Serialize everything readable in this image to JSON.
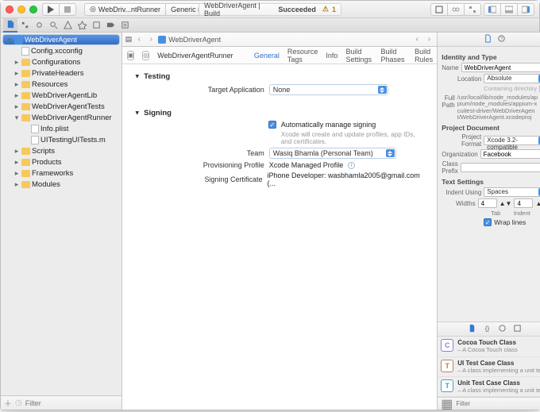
{
  "titlebar": {
    "scheme_left": "WebDriv...ntRunner",
    "scheme_right": "Generic iOS Device",
    "status_prefix": "WebDriverAgent | Build",
    "status_bold": "Succeeded",
    "warn_count": "1"
  },
  "jumpbar": {
    "back": "‹",
    "fwd": "›",
    "project": "WebDriverAgent",
    "list_icon": "≡"
  },
  "nav": {
    "items": [
      {
        "name": "WebDriverAgent",
        "type": "proj",
        "ind": 0,
        "sel": true,
        "tri": "open"
      },
      {
        "name": "Config.xcconfig",
        "type": "file",
        "ind": 1,
        "tri": "none"
      },
      {
        "name": "Configurations",
        "type": "folder",
        "ind": 1,
        "tri": "closed"
      },
      {
        "name": "PrivateHeaders",
        "type": "folder",
        "ind": 1,
        "tri": "closed"
      },
      {
        "name": "Resources",
        "type": "folder",
        "ind": 1,
        "tri": "closed"
      },
      {
        "name": "WebDriverAgentLib",
        "type": "folder",
        "ind": 1,
        "tri": "closed"
      },
      {
        "name": "WebDriverAgentTests",
        "type": "folder",
        "ind": 1,
        "tri": "closed"
      },
      {
        "name": "WebDriverAgentRunner",
        "type": "folder",
        "ind": 1,
        "tri": "open"
      },
      {
        "name": "Info.plist",
        "type": "file",
        "ind": 2,
        "tri": "none"
      },
      {
        "name": "UITestingUITests.m",
        "type": "file",
        "ind": 2,
        "tri": "none"
      },
      {
        "name": "Scripts",
        "type": "folder",
        "ind": 1,
        "tri": "closed"
      },
      {
        "name": "Products",
        "type": "folder",
        "ind": 1,
        "tri": "closed"
      },
      {
        "name": "Frameworks",
        "type": "folder",
        "ind": 1,
        "tri": "closed"
      },
      {
        "name": "Modules",
        "type": "folder",
        "ind": 1,
        "tri": "closed"
      }
    ],
    "filter_placeholder": "Filter"
  },
  "mid": {
    "target": "WebDriverAgentRunner",
    "tabs": [
      "General",
      "Resource Tags",
      "Info",
      "Build Settings",
      "Build Phases",
      "Build Rules"
    ],
    "active_tab": 0,
    "testing_hdr": "Testing",
    "target_app_label": "Target Application",
    "target_app_value": "None",
    "signing_hdr": "Signing",
    "auto_label": "Automatically manage signing",
    "auto_note": "Xcode will create and update profiles, app IDs, and certificates.",
    "team_label": "Team",
    "team_value": "Wasiq Bhamla (Personal Team)",
    "prov_label": "Provisioning Profile",
    "prov_value": "Xcode Managed Profile",
    "cert_label": "Signing Certificate",
    "cert_value": "iPhone Developer: wasbhamla2005@gmail.com (..."
  },
  "ins": {
    "identity_hdr": "Identity and Type",
    "name_k": "Name",
    "name_v": "WebDriverAgent",
    "loc_k": "Location",
    "loc_v": "Absolute",
    "contdir": "Containing directory",
    "fullpath_k": "Full Path",
    "fullpath_v": "/usr/local/lib/node_modules/appium/node_modules/appium-xcuitest-driver/WebDriverAgent/WebDriverAgent.xcodeproj",
    "projdoc_hdr": "Project Document",
    "projfmt_k": "Project Format",
    "projfmt_v": "Xcode 3.2-compatible",
    "org_k": "Organization",
    "org_v": "Facebook",
    "prefix_k": "Class Prefix",
    "prefix_v": "",
    "text_hdr": "Text Settings",
    "indent_k": "Indent Using",
    "indent_v": "Spaces",
    "widths_k": "Widths",
    "tab_v": "4",
    "indent_v2": "4",
    "tab_l": "Tab",
    "indent_l": "Indent",
    "wrap": "Wrap lines"
  },
  "lib": {
    "items": [
      {
        "badge": "C",
        "color": "#9b7bd4",
        "title": "Cocoa Touch Class",
        "desc": "A Cocoa Touch class"
      },
      {
        "badge": "T",
        "color": "#b0895a",
        "title": "UI Test Case Class",
        "desc": "A class implementing a unit test"
      },
      {
        "badge": "T",
        "color": "#4aa0c9",
        "title": "Unit Test Case Class",
        "desc": "A class implementing a unit test"
      }
    ],
    "filter_placeholder": "Filter"
  }
}
